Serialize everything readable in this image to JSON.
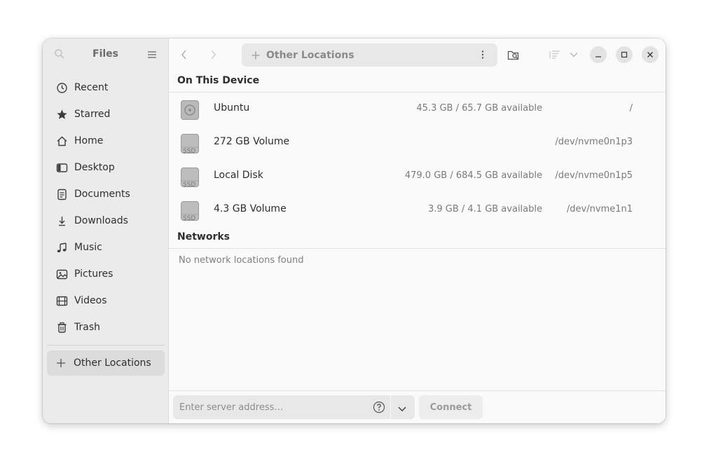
{
  "sidebar": {
    "title": "Files",
    "items": [
      {
        "label": "Recent",
        "icon": "clock-icon"
      },
      {
        "label": "Starred",
        "icon": "star-icon"
      },
      {
        "label": "Home",
        "icon": "home-icon"
      },
      {
        "label": "Desktop",
        "icon": "desktop-icon"
      },
      {
        "label": "Documents",
        "icon": "document-icon"
      },
      {
        "label": "Downloads",
        "icon": "download-icon"
      },
      {
        "label": "Music",
        "icon": "music-icon"
      },
      {
        "label": "Pictures",
        "icon": "picture-icon"
      },
      {
        "label": "Videos",
        "icon": "video-icon"
      },
      {
        "label": "Trash",
        "icon": "trash-icon"
      }
    ],
    "other_locations": "Other Locations"
  },
  "header": {
    "path_label": "Other Locations"
  },
  "on_this_device": {
    "title": "On This Device",
    "drives": [
      {
        "name": "Ubuntu",
        "available": "45.3 GB / 65.7 GB available",
        "mount": "/",
        "icon": "hard-disk-icon"
      },
      {
        "name": "272 GB Volume",
        "available": "",
        "mount": "/dev/nvme0n1p3",
        "icon": "ssd-icon"
      },
      {
        "name": "Local Disk",
        "available": "479.0 GB / 684.5 GB available",
        "mount": "/dev/nvme0n1p5",
        "icon": "ssd-icon"
      },
      {
        "name": "4.3 GB Volume",
        "available": "3.9 GB / 4.1 GB available",
        "mount": "/dev/nvme1n1",
        "icon": "ssd-icon"
      }
    ]
  },
  "networks": {
    "title": "Networks",
    "empty_message": "No network locations found"
  },
  "connect_bar": {
    "placeholder": "Enter server address…",
    "connect_label": "Connect"
  }
}
